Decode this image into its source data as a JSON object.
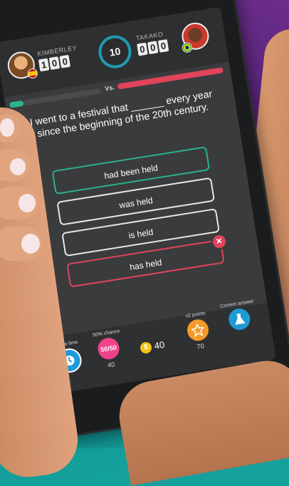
{
  "header": {
    "player1": {
      "name": "KIMBERLEY",
      "score_digits": [
        "1",
        "0",
        "0"
      ]
    },
    "player2": {
      "name": "TAKAKO",
      "score_digits": [
        "0",
        "0",
        "0"
      ]
    },
    "timer": "10",
    "vs_label": "Vs."
  },
  "question": {
    "text": "I went to a festival that ______ every year since the beginning of the 20th century."
  },
  "answers": [
    {
      "label": "had been held",
      "state": "correct"
    },
    {
      "label": "was held",
      "state": "neutral"
    },
    {
      "label": "is held",
      "state": "neutral"
    },
    {
      "label": "has held",
      "state": "wrong"
    }
  ],
  "wrong_mark": "✕",
  "powerups": {
    "extra_time": {
      "label": "Extra time",
      "icon": "clock-icon"
    },
    "fifty": {
      "label": "50% chance",
      "icon_text": "50/50",
      "count": "40"
    },
    "coins": {
      "icon_text": "$",
      "value": "40"
    },
    "double": {
      "label": "x2 points",
      "icon": "star-icon",
      "count": "70"
    },
    "correct": {
      "label": "Correct answer",
      "icon": "flask-icon"
    }
  },
  "colors": {
    "green": "#2bb28a",
    "red": "#e0445a",
    "pink": "#f0438a",
    "orange": "#f39a2a",
    "blue": "#1e9bd6",
    "teal": "#1aa6a0",
    "purple": "#5b2680"
  }
}
